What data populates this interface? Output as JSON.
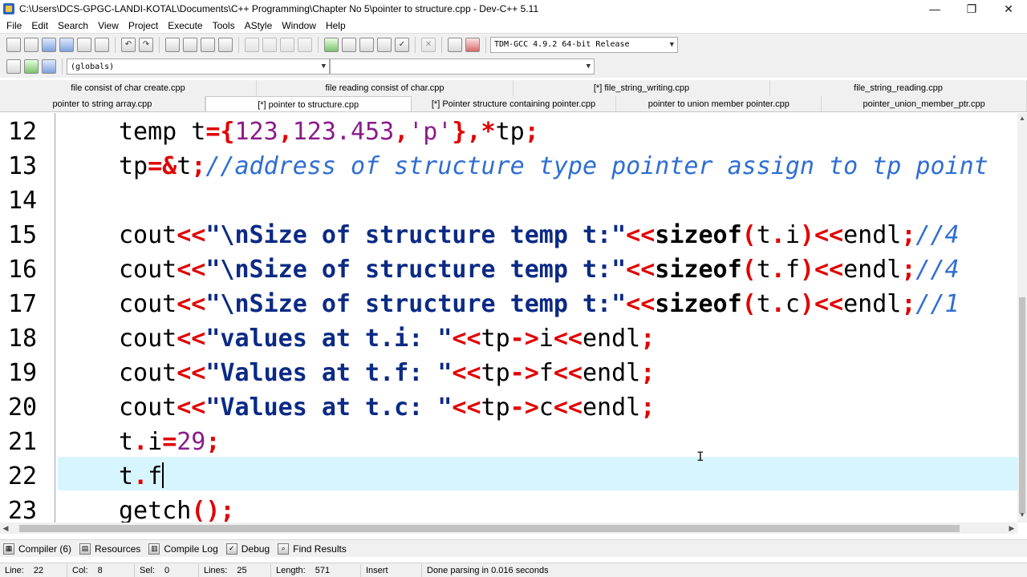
{
  "window": {
    "title": "C:\\Users\\DCS-GPGC-LANDI-KOTAL\\Documents\\C++ Programming\\Chapter No 5\\pointer to structure.cpp - Dev-C++ 5.11",
    "minimize": "—",
    "maximize": "❐",
    "close": "✕"
  },
  "menu": [
    "File",
    "Edit",
    "Search",
    "View",
    "Project",
    "Execute",
    "Tools",
    "AStyle",
    "Window",
    "Help"
  ],
  "toolbar": {
    "compiler_select": "TDM-GCC 4.9.2 64-bit Release",
    "scope_select": "(globals)",
    "function_select": ""
  },
  "tabs_row1": [
    "file consist of char create.cpp",
    "file reading consist of char.cpp",
    "[*] file_string_writing.cpp",
    "file_string_reading.cpp"
  ],
  "tabs_row2": [
    "pointer to string array.cpp",
    "[*] pointer to structure.cpp",
    "[*] Pointer structure containing pointer.cpp",
    "pointer to union member pointer.cpp",
    "pointer_union_member_ptr.cpp"
  ],
  "active_tab_index": 1,
  "editor": {
    "line_numbers": [
      "12",
      "13",
      "14",
      "15",
      "16",
      "17",
      "18",
      "19",
      "20",
      "21",
      "22",
      "23"
    ],
    "current_line": "22"
  },
  "bottom_tabs": [
    {
      "label": "Compiler (6)",
      "icon": "compiler-icon"
    },
    {
      "label": "Resources",
      "icon": "resources-icon"
    },
    {
      "label": "Compile Log",
      "icon": "compile-log-icon"
    },
    {
      "label": "Debug",
      "icon": "debug-icon"
    },
    {
      "label": "Find Results",
      "icon": "find-results-icon"
    }
  ],
  "status": {
    "line_label": "Line:",
    "line_value": "22",
    "col_label": "Col:",
    "col_value": "8",
    "sel_label": "Sel:",
    "sel_value": "0",
    "lines_label": "Lines:",
    "lines_value": "25",
    "length_label": "Length:",
    "length_value": "571",
    "mode": "Insert",
    "message": "Done parsing in 0.016 seconds"
  }
}
